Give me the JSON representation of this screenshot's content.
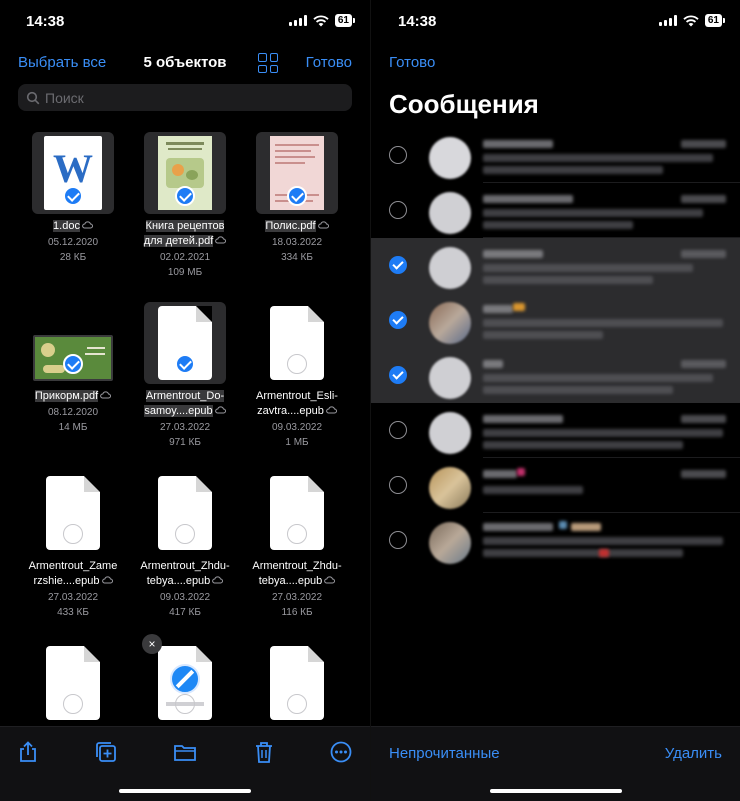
{
  "left": {
    "status": {
      "time": "14:38",
      "battery": "61"
    },
    "header": {
      "select_all": "Выбрать все",
      "title": "5 объектов",
      "done": "Готово"
    },
    "search": {
      "placeholder": "Поиск"
    },
    "files": [
      {
        "name": "1.doc",
        "date": "05.12.2020",
        "size": "28 КБ",
        "selected": true
      },
      {
        "name": "Книга рецептов для детей.pdf",
        "name_lines": [
          "Книга рецептов",
          "для детей.pdf"
        ],
        "date": "02.02.2021",
        "size": "109 МБ",
        "selected": true
      },
      {
        "name": "Полис.pdf",
        "date": "18.03.2022",
        "size": "334 КБ",
        "selected": true
      },
      {
        "name": "Прикорм.pdf",
        "date": "08.12.2020",
        "size": "14 МБ",
        "selected": true
      },
      {
        "name_lines": [
          "Armentrout_Do-",
          "samoy....epub"
        ],
        "date": "27.03.2022",
        "size": "971 КБ",
        "selected": true
      },
      {
        "name_lines": [
          "Armentrout_Esli-",
          "zavtra....epub"
        ],
        "date": "09.03.2022",
        "size": "1 МБ",
        "selected": false
      },
      {
        "name_lines": [
          "Armentrout_Zame",
          "rzshie....epub"
        ],
        "date": "27.03.2022",
        "size": "433 КБ",
        "selected": false
      },
      {
        "name_lines": [
          "Armentrout_Zhdu-",
          "tebya....epub"
        ],
        "date": "09.03.2022",
        "size": "417 КБ",
        "selected": false
      },
      {
        "name_lines": [
          "Armentrout_Zhdu-",
          "tebya....epub"
        ],
        "date": "27.03.2022",
        "size": "116 КБ",
        "selected": false
      }
    ],
    "toolbar": [
      "share-icon",
      "add-copy-icon",
      "folder-icon",
      "trash-icon",
      "more-icon"
    ]
  },
  "right": {
    "status": {
      "time": "14:38",
      "battery": "61"
    },
    "header": {
      "done": "Готово",
      "title": "Сообщения"
    },
    "rows": [
      {
        "selected": false
      },
      {
        "selected": false
      },
      {
        "selected": true
      },
      {
        "selected": true
      },
      {
        "selected": true
      },
      {
        "selected": false
      },
      {
        "selected": false
      },
      {
        "selected": false
      }
    ],
    "toolbar": {
      "unread": "Непрочитанные",
      "delete": "Удалить"
    }
  },
  "colors": {
    "accent": "#3a8ef6",
    "background": "#000000",
    "selected_row": "#2c2c2e"
  }
}
